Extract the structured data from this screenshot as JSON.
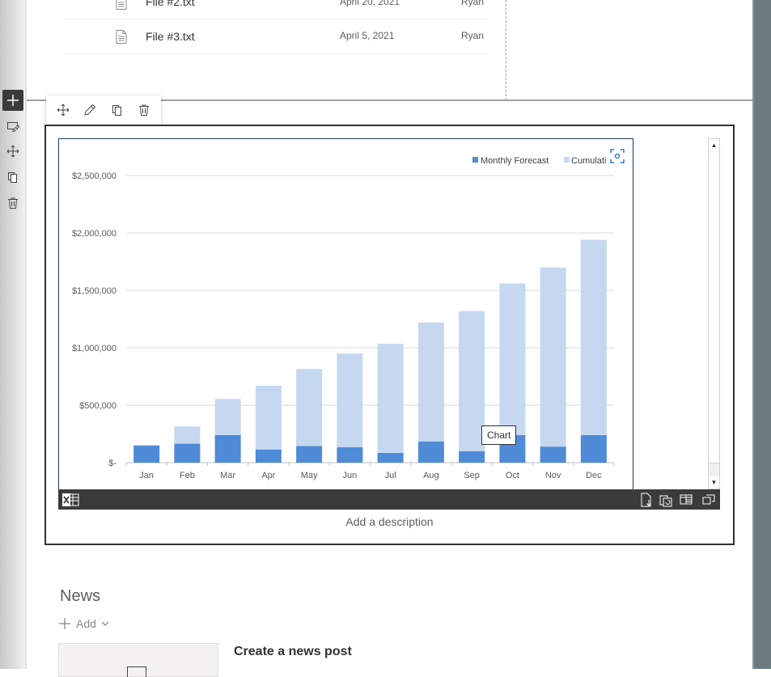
{
  "files": [
    {
      "name": "File #2.txt",
      "date": "April 20, 2021",
      "author": "Ryan C"
    },
    {
      "name": "File #3.txt",
      "date": "April 5, 2021",
      "author": "Ryan C"
    }
  ],
  "webpart": {
    "description_placeholder": "Add a description",
    "tooltip": "Chart"
  },
  "news": {
    "title": "News",
    "add_label": "Add",
    "create_post": "Create a news post"
  },
  "colors": {
    "monthly": "#4f8bd6",
    "cumulative": "#c5d8f0",
    "dark_bar": "#3b3b3b"
  },
  "icons": {
    "file": "document-icon",
    "add_section": "plus-icon",
    "edit_section": "edit-section-icon",
    "move": "move-icon",
    "duplicate": "duplicate-icon",
    "delete": "trash-icon",
    "edit_webpart": "pencil-icon",
    "focus": "focus-icon",
    "excel": "excel-logo-icon"
  },
  "chart_data": {
    "type": "bar",
    "stacked": true,
    "categories": [
      "Jan",
      "Feb",
      "Mar",
      "Apr",
      "May",
      "Jun",
      "Jul",
      "Aug",
      "Sep",
      "Oct",
      "Nov",
      "Dec"
    ],
    "series": [
      {
        "name": "Monthly Forecast",
        "values": [
          150000,
          165000,
          240000,
          115000,
          145000,
          135000,
          85000,
          185000,
          100000,
          240000,
          140000,
          240000
        ]
      },
      {
        "name": "Cumulative",
        "values": [
          0,
          150000,
          315000,
          555000,
          670000,
          815000,
          950000,
          1035000,
          1220000,
          1320000,
          1560000,
          1700000
        ]
      }
    ],
    "legend_visible": [
      "Monthly Forecast",
      "Cumulati"
    ],
    "y_ticks": [
      "$-",
      "$500,000",
      "$1,000,000",
      "$1,500,000",
      "$2,000,000",
      "$2,500,000"
    ],
    "y_tick_values": [
      0,
      500000,
      1000000,
      1500000,
      2000000,
      2500000
    ],
    "ylim": [
      0,
      2500000
    ],
    "grid": true,
    "legend_position": "top-right"
  }
}
